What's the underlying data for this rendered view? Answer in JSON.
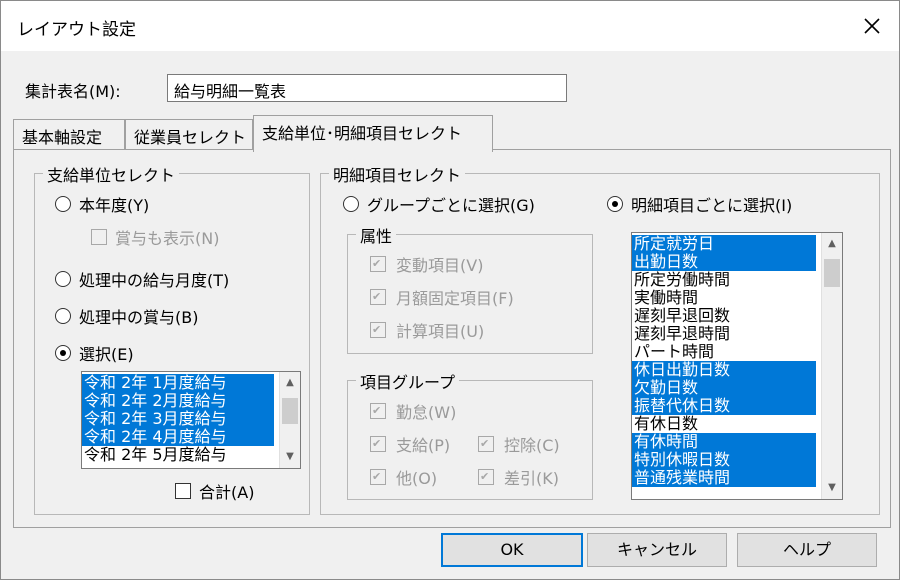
{
  "window": {
    "title": "レイアウト設定"
  },
  "report_name": {
    "label": "集計表名(M):",
    "value": "給与明細一覧表"
  },
  "tabs": [
    {
      "label": "基本軸設定"
    },
    {
      "label": "従業員セレクト"
    },
    {
      "label": "支給単位･明細項目セレクト"
    }
  ],
  "pay_unit": {
    "title": "支給単位セレクト",
    "radio_current_year": "本年度(Y)",
    "checkbox_show_bonus": "賞与も表示(N)",
    "radio_current_month": "処理中の給与月度(T)",
    "radio_current_bonus": "処理中の賞与(B)",
    "radio_select": "選択(E)",
    "list": [
      {
        "label": "令和 2年 1月度給与"
      },
      {
        "label": "令和 2年 2月度給与"
      },
      {
        "label": "令和 2年 3月度給与"
      },
      {
        "label": "令和 2年 4月度給与"
      },
      {
        "label": "令和 2年 5月度給与"
      }
    ],
    "checkbox_total": "合計(A)"
  },
  "detail": {
    "title": "明細項目セレクト",
    "radio_by_group": "グループごとに選択(G)",
    "radio_by_item": "明細項目ごとに選択(I)",
    "attributes": {
      "title": "属性",
      "items": [
        "変動項目(V)",
        "月額固定項目(F)",
        "計算項目(U)"
      ]
    },
    "item_group": {
      "title": "項目グループ",
      "items": [
        "勤怠(W)",
        "支給(P)",
        "控除(C)",
        "他(O)",
        "差引(K)"
      ]
    },
    "items": [
      {
        "label": "所定就労日"
      },
      {
        "label": "出勤日数"
      },
      {
        "label": "所定労働時間"
      },
      {
        "label": "実働時間"
      },
      {
        "label": "遅刻早退回数"
      },
      {
        "label": "遅刻早退時間"
      },
      {
        "label": "パート時間"
      },
      {
        "label": "休日出勤日数"
      },
      {
        "label": "欠勤日数"
      },
      {
        "label": "振替代休日数"
      },
      {
        "label": "有休日数"
      },
      {
        "label": "有休時間"
      },
      {
        "label": "特別休暇日数"
      },
      {
        "label": "普通残業時間"
      }
    ]
  },
  "buttons": {
    "ok": "OK",
    "cancel": "キャンセル",
    "help": "ヘルプ"
  }
}
